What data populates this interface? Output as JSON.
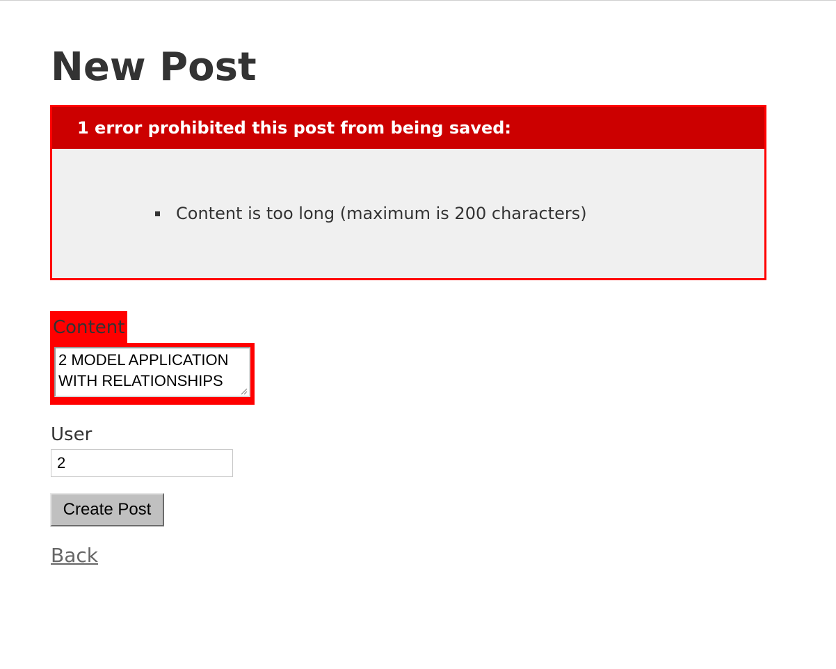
{
  "page": {
    "title": "New Post"
  },
  "errors": {
    "header": "1 error prohibited this post from being saved:",
    "items": [
      "Content is too long (maximum is 200 characters)"
    ]
  },
  "form": {
    "content_label": "Content",
    "content_value": "2 MODEL APPLICATION WITH RELATIONSHIPS",
    "user_label": "User",
    "user_value": "2",
    "submit_label": "Create Post"
  },
  "nav": {
    "back_label": "Back"
  },
  "colors": {
    "error_border": "#ff0000",
    "error_header_bg": "#cc0000",
    "error_body_bg": "#f0f0f0",
    "text": "#333333",
    "link": "#666666",
    "button_bg": "#c0c0c0"
  }
}
